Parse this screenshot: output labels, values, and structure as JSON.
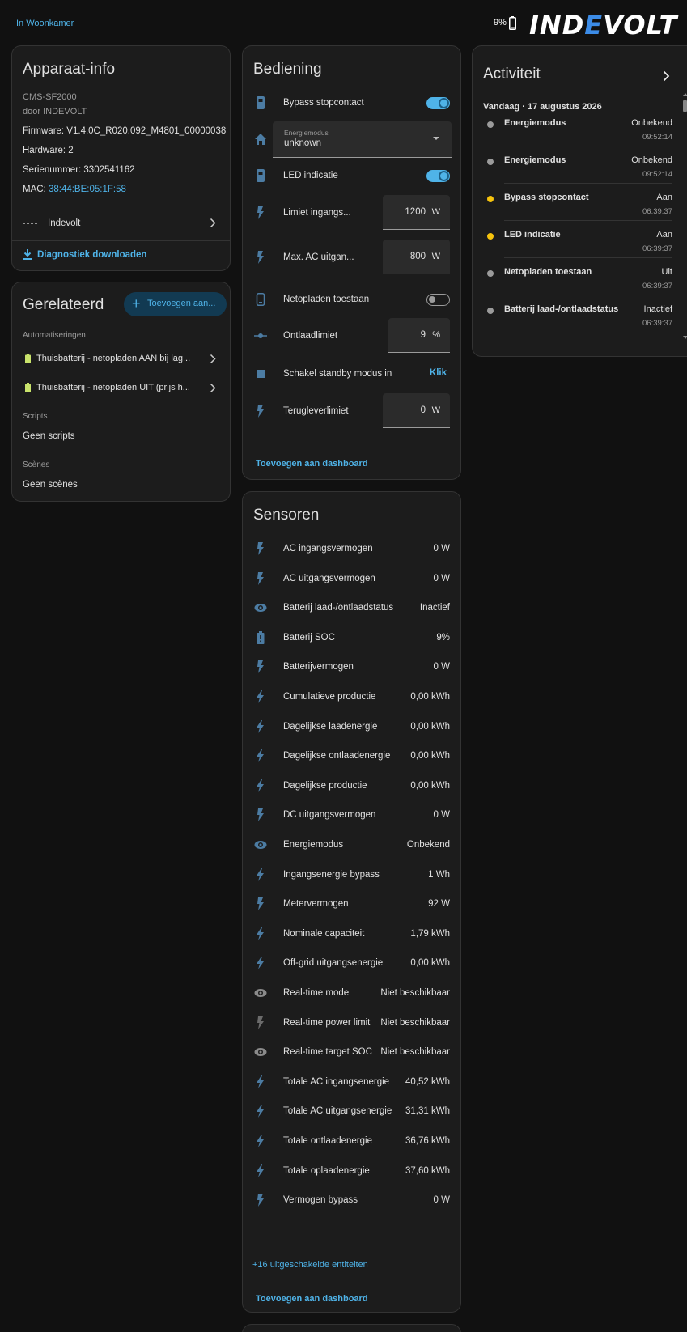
{
  "breadcrumb": "In Woonkamer",
  "header": {
    "battery_percent": "9%",
    "logo_text_pre": "IND",
    "logo_text_e": "E",
    "logo_text_post": "VOLT"
  },
  "colors": {
    "accent": "#4fb3e8",
    "card_bg": "#1c1c1c",
    "page_bg": "#111111",
    "icon": "#4c7ca3",
    "yellow": "#f6c30d"
  },
  "device_info": {
    "title": "Apparaat-info",
    "model": "CMS-SF2000",
    "manufacturer": "door INDEVOLT",
    "firmware": "Firmware: V1.4.0C_R020.092_M4801_00000038",
    "hardware": "Hardware: 2",
    "serial": "Serienummer: 3302541162",
    "mac_label": "MAC: ",
    "mac_value": "38:44:BE:05:1F:58",
    "integration": "Indevolt",
    "download": "Diagnostiek downloaden"
  },
  "related": {
    "title": "Gerelateerd",
    "add_button": "Toevoegen aan...",
    "automations_header": "Automatiseringen",
    "automations": [
      "Thuisbatterij - netopladen AAN bij lag...",
      "Thuisbatterij - netopladen UIT (prijs h..."
    ],
    "scripts_header": "Scripts",
    "scripts_empty": "Geen scripts",
    "scenes_header": "Scènes",
    "scenes_empty": "Geen scènes"
  },
  "controls": {
    "title": "Bediening",
    "bypass": "Bypass stopcontact",
    "energy_mode_label": "Energiemodus",
    "energy_mode_value": "unknown",
    "led": "LED indicatie",
    "input_limit": "Limiet ingangs...",
    "input_limit_value": "1200",
    "input_limit_unit": "W",
    "ac_output": "Max. AC uitgan...",
    "ac_output_value": "800",
    "ac_output_unit": "W",
    "grid_charge": "Netopladen toestaan",
    "discharge_limit": "Ontlaadlimiet",
    "discharge_limit_value": "9",
    "discharge_limit_unit": "%",
    "standby": "Schakel standby modus in",
    "standby_action": "Klik",
    "feedback_limit": "Terugleverlimiet",
    "feedback_limit_value": "0",
    "feedback_limit_unit": "W",
    "add_dashboard": "Toevoegen aan dashboard"
  },
  "sensors": {
    "title": "Sensoren",
    "items": [
      {
        "label": "AC ingangsvermogen",
        "value": "0 W",
        "icon": "flash-icon"
      },
      {
        "label": "AC uitgangsvermogen",
        "value": "0 W",
        "icon": "flash-icon"
      },
      {
        "label": "Batterij laad-/ontlaadstatus",
        "value": "Inactief",
        "icon": "eye-icon"
      },
      {
        "label": "Batterij SOC",
        "value": "9%",
        "icon": "battery-icon"
      },
      {
        "label": "Batterijvermogen",
        "value": "0 W",
        "icon": "flash-icon"
      },
      {
        "label": "Cumulatieve productie",
        "value": "0,00 kWh",
        "icon": "lightning-icon"
      },
      {
        "label": "Dagelijkse laadenergie",
        "value": "0,00 kWh",
        "icon": "lightning-icon"
      },
      {
        "label": "Dagelijkse ontlaadenergie",
        "value": "0,00 kWh",
        "icon": "lightning-icon"
      },
      {
        "label": "Dagelijkse productie",
        "value": "0,00 kWh",
        "icon": "lightning-icon"
      },
      {
        "label": "DC uitgangsvermogen",
        "value": "0 W",
        "icon": "flash-icon"
      },
      {
        "label": "Energiemodus",
        "value": "Onbekend",
        "icon": "eye-icon"
      },
      {
        "label": "Ingangsenergie bypass",
        "value": "1 Wh",
        "icon": "lightning-icon"
      },
      {
        "label": "Metervermogen",
        "value": "92 W",
        "icon": "flash-icon"
      },
      {
        "label": "Nominale capaciteit",
        "value": "1,79 kWh",
        "icon": "lightning-icon"
      },
      {
        "label": "Off-grid uitgangsenergie",
        "value": "0,00 kWh",
        "icon": "lightning-icon"
      },
      {
        "label": "Real-time mode",
        "value": "Niet beschikbaar",
        "icon": "eye-icon-dim"
      },
      {
        "label": "Real-time power limit",
        "value": "Niet beschikbaar",
        "icon": "flash-icon-dim"
      },
      {
        "label": "Real-time target SOC",
        "value": "Niet beschikbaar",
        "icon": "eye-icon-dim"
      },
      {
        "label": "Totale AC ingangsenergie",
        "value": "40,52 kWh",
        "icon": "lightning-icon"
      },
      {
        "label": "Totale AC uitgangsenergie",
        "value": "31,31 kWh",
        "icon": "lightning-icon"
      },
      {
        "label": "Totale ontlaadenergie",
        "value": "36,76 kWh",
        "icon": "lightning-icon"
      },
      {
        "label": "Totale oplaadenergie",
        "value": "37,60 kWh",
        "icon": "lightning-icon"
      },
      {
        "label": "Vermogen bypass",
        "value": "0 W",
        "icon": "flash-icon"
      }
    ],
    "disabled_entities": "+16 uitgeschakelde entiteiten",
    "add_dashboard": "Toevoegen aan dashboard"
  },
  "activity": {
    "title": "Activiteit",
    "date": "Vandaag · 17 augustus 2026",
    "items": [
      {
        "name": "Energiemodus",
        "state": "Onbekend",
        "time": "09:52:14",
        "dot": "grey"
      },
      {
        "name": "Energiemodus",
        "state": "Onbekend",
        "time": "09:52:14",
        "dot": "grey"
      },
      {
        "name": "Bypass stopcontact",
        "state": "Aan",
        "time": "06:39:37",
        "dot": "yellow"
      },
      {
        "name": "LED indicatie",
        "state": "Aan",
        "time": "06:39:37",
        "dot": "yellow"
      },
      {
        "name": "Netopladen toestaan",
        "state": "Uit",
        "time": "06:39:37",
        "dot": "grey"
      },
      {
        "name": "Batterij laad-/ontlaadstatus",
        "state": "Inactief",
        "time": "06:39:37",
        "dot": "grey"
      }
    ]
  }
}
